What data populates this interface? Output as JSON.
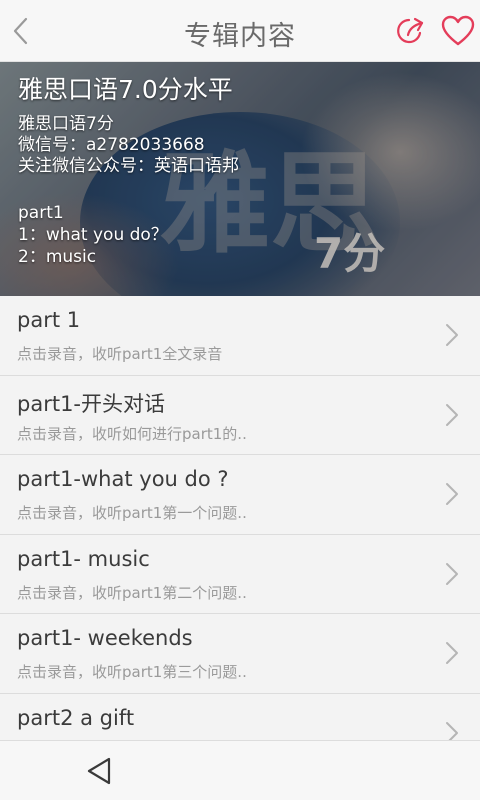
{
  "header": {
    "title": "专辑内容",
    "accent_color": "#e43d5a"
  },
  "banner": {
    "title": "雅思口语7.0分水平",
    "lines": [
      "雅思口语7分",
      "微信号：a2782033668",
      "关注微信公众号：英语口语邦",
      "part1",
      "1：what you do？",
      "2：music"
    ],
    "image_text_large": "雅思",
    "image_text_small": "7分"
  },
  "items": [
    {
      "title": "part 1",
      "subtitle": "点击录音，收听part1全文录音"
    },
    {
      "title": "part1-开头对话",
      "subtitle": "点击录音，收听如何进行part1的.."
    },
    {
      "title": "part1-what you do ?",
      "subtitle": "点击录音，收听part1第一个问题.."
    },
    {
      "title": "part1- music",
      "subtitle": "点击录音，收听part1第二个问题.."
    },
    {
      "title": "part1- weekends",
      "subtitle": "点击录音，收听part1第三个问题.."
    },
    {
      "title": "part2 a gift",
      "subtitle": ""
    }
  ],
  "icons": {
    "back": "chevron-left-icon",
    "share": "share-icon",
    "favorite": "heart-icon",
    "item_arrow": "chevron-right-icon",
    "nav_back": "triangle-back-icon"
  }
}
